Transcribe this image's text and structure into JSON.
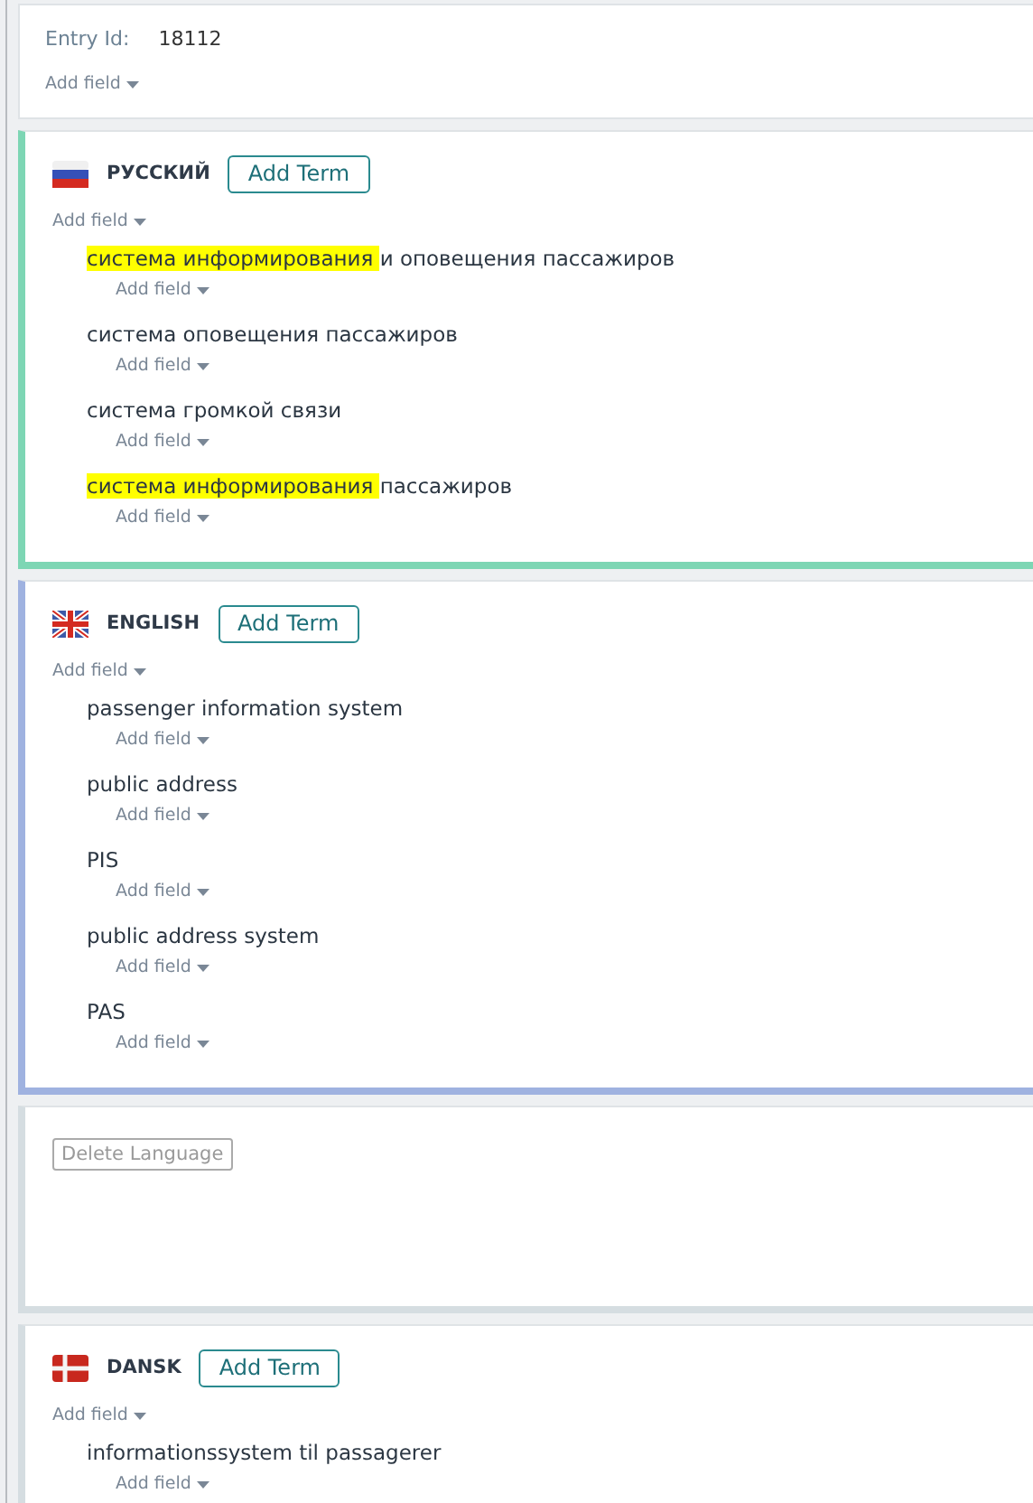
{
  "entry": {
    "label": "Entry Id:",
    "value": "18112",
    "add_field": "Add field"
  },
  "languages": [
    {
      "kind": "ru",
      "name": "РУССКИЙ",
      "color": "#7dd6b4",
      "add_term": "Add Term",
      "add_field": "Add field",
      "terms": [
        {
          "segments": [
            {
              "text": "система информирования ",
              "highlight": true
            },
            {
              "text": "и оповещения пассажиров",
              "highlight": false
            }
          ],
          "add_field": "Add field"
        },
        {
          "segments": [
            {
              "text": "система оповещения пассажиров",
              "highlight": false
            }
          ],
          "add_field": "Add field"
        },
        {
          "segments": [
            {
              "text": "система громкой связи",
              "highlight": false
            }
          ],
          "add_field": "Add field"
        },
        {
          "segments": [
            {
              "text": "система информирования ",
              "highlight": true
            },
            {
              "text": "пассажиров",
              "highlight": false
            }
          ],
          "add_field": "Add field"
        }
      ]
    },
    {
      "kind": "gb",
      "name": "ENGLISH",
      "color": "#9fb2e0",
      "add_term": "Add Term",
      "add_field": "Add field",
      "terms": [
        {
          "segments": [
            {
              "text": "passenger information system",
              "highlight": false
            }
          ],
          "add_field": "Add field"
        },
        {
          "segments": [
            {
              "text": "public address",
              "highlight": false
            }
          ],
          "add_field": "Add field"
        },
        {
          "segments": [
            {
              "text": "PIS",
              "highlight": false
            }
          ],
          "add_field": "Add field"
        },
        {
          "segments": [
            {
              "text": "public address system",
              "highlight": false
            }
          ],
          "add_field": "Add field"
        },
        {
          "segments": [
            {
              "text": "PAS",
              "highlight": false
            }
          ],
          "add_field": "Add field"
        }
      ]
    }
  ],
  "delete_language": {
    "label": "Delete Language",
    "disabled": true
  },
  "more_languages": [
    {
      "kind": "dk",
      "name": "DANSK",
      "color": "#d5dde1",
      "add_term": "Add Term",
      "add_field": "Add field",
      "terms": [
        {
          "segments": [
            {
              "text": "informationssystem til passagerer",
              "highlight": false
            }
          ],
          "add_field": "Add field"
        }
      ]
    }
  ]
}
